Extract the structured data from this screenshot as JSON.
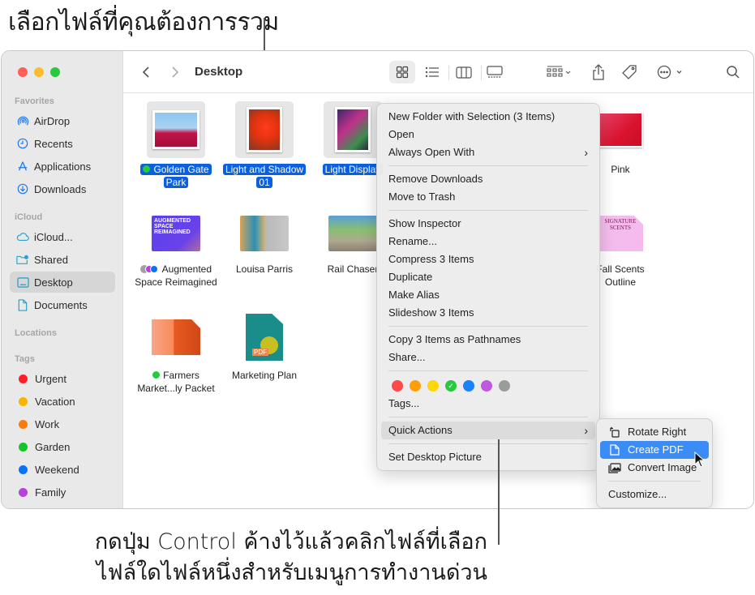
{
  "annotations": {
    "top": "เลือกไฟล์ที่คุณต้องการรวม",
    "bottom_line1": "กดปุ่ม Control ค้างไว้แล้วคลิกไฟล์ที่เลือก",
    "bottom_line2": "ไฟล์ใดไฟล์หนึ่งสำหรับเมนูการทำงานด่วน"
  },
  "window": {
    "title": "Desktop",
    "traffic_lights": {
      "close": "#fe5f57",
      "minimize": "#febc2e",
      "zoom": "#28c840"
    }
  },
  "toolbar": {
    "back_icon": "chevron-left-icon",
    "forward_icon": "chevron-right-icon",
    "views": [
      "icon-view",
      "list-view",
      "column-view",
      "gallery-view"
    ],
    "selected_view": "icon-view"
  },
  "sidebar": {
    "sections": [
      {
        "title": "Favorites",
        "items": [
          {
            "label": "AirDrop",
            "icon": "airdrop-icon"
          },
          {
            "label": "Recents",
            "icon": "clock-icon"
          },
          {
            "label": "Applications",
            "icon": "applications-icon"
          },
          {
            "label": "Downloads",
            "icon": "download-icon"
          }
        ]
      },
      {
        "title": "iCloud",
        "items": [
          {
            "label": "iCloud...",
            "icon": "cloud-icon"
          },
          {
            "label": "Shared",
            "icon": "shared-folder-icon"
          },
          {
            "label": "Desktop",
            "icon": "desktop-icon",
            "selected": true
          },
          {
            "label": "Documents",
            "icon": "document-icon"
          }
        ]
      },
      {
        "title": "Locations",
        "items": []
      },
      {
        "title": "Tags",
        "items": [
          {
            "label": "Urgent",
            "color": "#fe1e28"
          },
          {
            "label": "Vacation",
            "color": "#f7b500"
          },
          {
            "label": "Work",
            "color": "#fb7c0c"
          },
          {
            "label": "Garden",
            "color": "#15c427"
          },
          {
            "label": "Weekend",
            "color": "#0a72f7"
          },
          {
            "label": "Family",
            "color": "#b542db"
          }
        ]
      }
    ]
  },
  "files": [
    {
      "name_line1": "Golden Gate",
      "name_line2": "Park",
      "selected": true,
      "tag": "#27c93f"
    },
    {
      "name_line1": "Light and Shadow",
      "name_line2": "01",
      "selected": true
    },
    {
      "name_line1": "Light Display",
      "selected": true
    },
    {
      "name_line1": "Pink"
    },
    {
      "name_line1": "Augmented",
      "name_line2": "Space Reimagined",
      "tags": [
        "#a0a0a0",
        "#b542db",
        "#0a72f7"
      ]
    },
    {
      "name_line1": "Louisa Parris"
    },
    {
      "name_line1": "Rail Chaser"
    },
    {
      "name_line1": "Fall Scents",
      "name_line2": "Outline"
    },
    {
      "name_line1": "Farmers",
      "name_line2": "Market...ly Packet",
      "tag": "#27c93f"
    },
    {
      "name_line1": "Marketing Plan"
    }
  ],
  "context_menu": {
    "groups": [
      [
        "New Folder with Selection (3 Items)",
        "Open",
        "Always Open With"
      ],
      [
        "Remove Downloads",
        "Move to Trash"
      ],
      [
        "Show Inspector",
        "Rename...",
        "Compress 3 Items",
        "Duplicate",
        "Make Alias",
        "Slideshow 3 Items"
      ],
      [
        "Copy 3 Items as Pathnames",
        "Share..."
      ]
    ],
    "tag_colors": [
      "#fe4a49",
      "#fe9f0a",
      "#fed60a",
      "#2ac83f",
      "#1a82fb",
      "#bf5ae0",
      "#9b9b9b"
    ],
    "tag_checked_index": 3,
    "tags_label": "Tags...",
    "quick_actions": "Quick Actions",
    "set_desktop_picture": "Set Desktop Picture",
    "submenu_indicator": ">"
  },
  "quick_actions_menu": {
    "items": [
      {
        "label": "Rotate Right",
        "icon": "rotate-right-icon"
      },
      {
        "label": "Create PDF",
        "icon": "pdf-document-icon",
        "active": true
      },
      {
        "label": "Convert Image",
        "icon": "convert-image-icon"
      }
    ],
    "customize": "Customize..."
  }
}
